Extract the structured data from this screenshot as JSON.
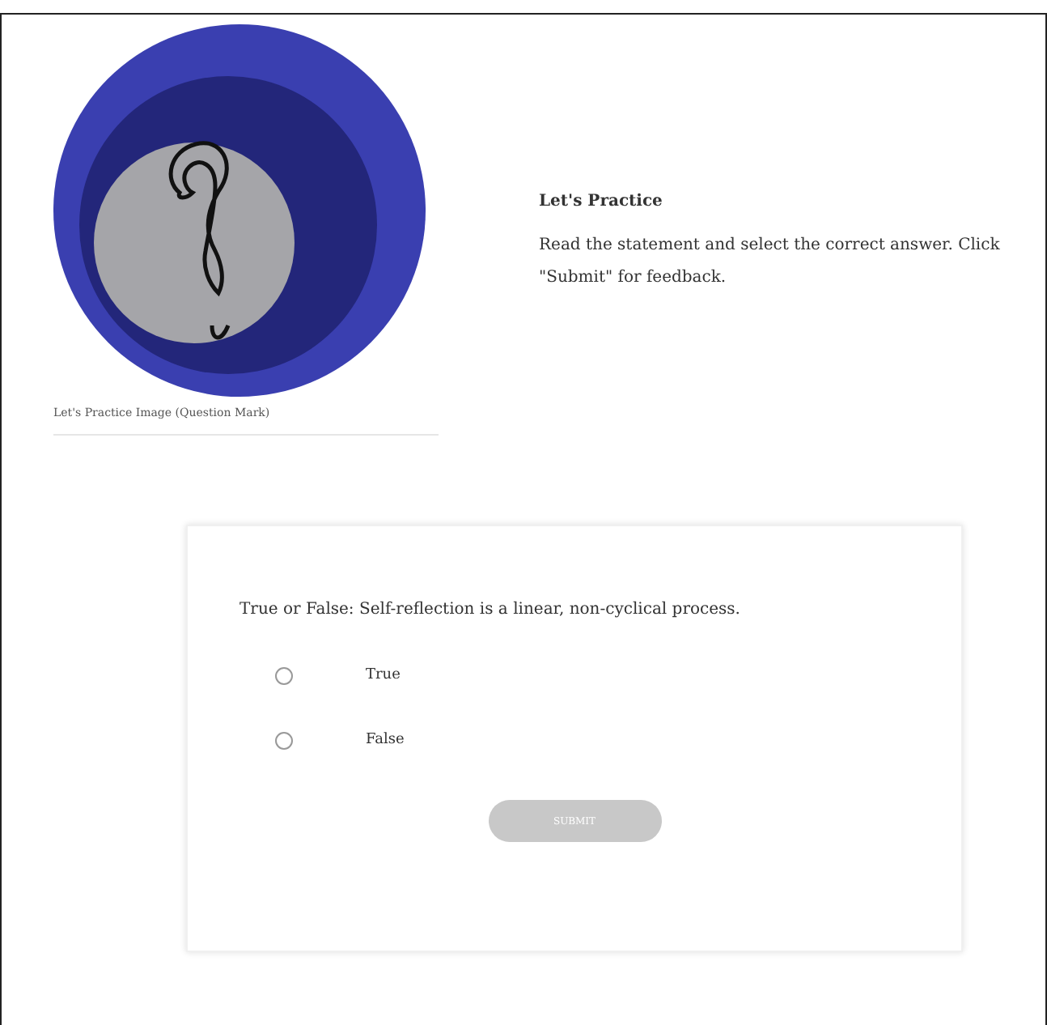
{
  "figure": {
    "caption": "Let's Practice Image (Question Mark)"
  },
  "intro": {
    "heading": "Let's Practice",
    "instructions": "Read the statement and select the correct answer. Click \"Submit\" for feedback."
  },
  "question": {
    "prompt": "True or False: Self-reflection is a linear, non-cyclical process.",
    "options": [
      {
        "label": "True",
        "selected": false
      },
      {
        "label": "False",
        "selected": false
      }
    ],
    "submit": {
      "label": "SUBMIT",
      "disabled": true
    }
  }
}
